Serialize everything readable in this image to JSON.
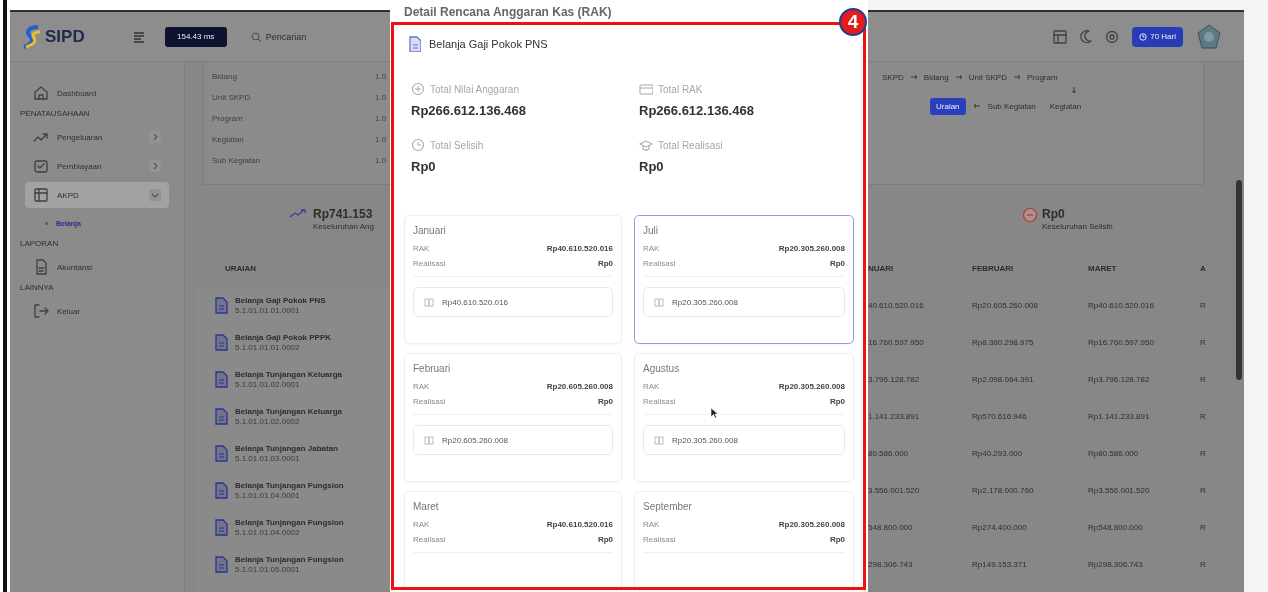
{
  "topbar": {
    "logo": "SIPD",
    "timer": "154.43 ms",
    "search_placeholder": "Pencarian",
    "days_button": "70 Hari"
  },
  "sidebar": {
    "items": [
      {
        "kind": "link",
        "label": "Dashboard",
        "selected": false
      },
      {
        "kind": "section",
        "label": "PENATAUSAHAAN"
      },
      {
        "kind": "link",
        "label": "Pengeluaran",
        "selected": false,
        "expanded": false
      },
      {
        "kind": "link",
        "label": "Pembiayaan",
        "selected": false,
        "expanded": false
      },
      {
        "kind": "link",
        "label": "AKPD",
        "selected": true,
        "expanded": true,
        "children": [
          {
            "label": "Belanja",
            "selected": true
          }
        ]
      },
      {
        "kind": "section",
        "label": "LAPORAN"
      },
      {
        "kind": "link",
        "label": "Akuntansi",
        "selected": false
      },
      {
        "kind": "section",
        "label": "LAINNYA"
      },
      {
        "kind": "link",
        "label": "Keluar",
        "selected": false
      }
    ]
  },
  "info": {
    "rows": [
      {
        "label": "Bidang",
        "value": "1.0"
      },
      {
        "label": "Unit SKPD",
        "value": "1.0"
      },
      {
        "label": "Program",
        "value": "1.0"
      },
      {
        "label": "Kegiatan",
        "value": "1.0"
      },
      {
        "label": "Sub Kegiatan",
        "value": "1.0"
      }
    ],
    "flow_top": [
      "SKPD",
      "Bidang",
      "Unit SKPD",
      "Program"
    ],
    "flow_bottom": [
      {
        "label": "Uraian",
        "selected": true
      },
      {
        "label": "Sub Kegiatan",
        "selected": false
      },
      {
        "label": "Kegiatan",
        "selected": false
      }
    ]
  },
  "stats": [
    {
      "kind": "trend",
      "amount": "Rp741.153",
      "caption": "Keseluruhan Ang"
    },
    {
      "kind": "diff",
      "amount": "Rp0",
      "caption": "Keseluruhan Selisih"
    }
  ],
  "table": {
    "columns": [
      "URAIAN",
      "NUARI",
      "FEBRUARI",
      "MARET",
      "A"
    ],
    "rows": [
      {
        "title": "Belanja Gaji Pokok PNS",
        "code": "5.1.01.01.01.0001",
        "values": [
          "40.610.520.016",
          "Rp20.605.260.008",
          "Rp40.610.520.016",
          "R"
        ]
      },
      {
        "title": "Belanja Gaji Pokok PPPK",
        "code": "5.1.01.01.01.0002",
        "values": [
          "16.760.597.950",
          "Rp8.380.298.975",
          "Rp16.760.597.950",
          "R"
        ]
      },
      {
        "title": "Belanja Tunjangan Keluarga",
        "code": "5.1.01.01.02.0001",
        "values": [
          "3.796.128.782",
          "Rp2.098.064.391",
          "Rp3.796.128.782",
          "R"
        ]
      },
      {
        "title": "Belanja Tunjangan Keluarga",
        "code": "5.1.01.01.02.0002",
        "values": [
          "1.141.233.891",
          "Rp570.616.946",
          "Rp1.141.233.891",
          "R"
        ]
      },
      {
        "title": "Belanja Tunjangan Jabatan",
        "code": "5.1.01.01.03.0001",
        "values": [
          "80.586.000",
          "Rp40.293.000",
          "Rp80.586.000",
          "R"
        ]
      },
      {
        "title": "Belanja Tunjangan Fungsion",
        "code": "5.1.01.01.04.0001",
        "values": [
          "3.556.001.520",
          "Rp2.178.000.760",
          "Rp3.556.001.520",
          "R"
        ]
      },
      {
        "title": "Belanja Tunjangan Fungsion",
        "code": "5.1.01.01.04.0002",
        "values": [
          "548.800.000",
          "Rp274.400.000",
          "Rp548.800.000",
          "R"
        ]
      },
      {
        "title": "Belanja Tunjangan Fungsion",
        "code": "5.1.01.01.05.0001",
        "values": [
          "298.306.743",
          "Rp149.153.371",
          "Rp298.306.743",
          "R"
        ]
      }
    ]
  },
  "modal": {
    "title": "Detail Rencana Anggaran Kas (RAK)",
    "item": "Belanja Gaji Pokok PNS",
    "summary": [
      {
        "label": "Total Nilai Anggaran",
        "value": "Rp266.612.136.468"
      },
      {
        "label": "Total RAK",
        "value": "Rp266.612.136.468"
      },
      {
        "label": "Total Selisih",
        "value": "Rp0"
      },
      {
        "label": "Total Realisasi",
        "value": "Rp0"
      }
    ],
    "months": [
      {
        "name": "Januari",
        "selected": false,
        "rows": [
          {
            "label": "RAK",
            "value": "Rp40.610.520.016"
          },
          {
            "label": "Realisasi",
            "value": "Rp0"
          }
        ],
        "input": "Rp40.610.520.016"
      },
      {
        "name": "Juli",
        "selected": true,
        "rows": [
          {
            "label": "RAK",
            "value": "Rp20.305.260.008"
          },
          {
            "label": "Realisasi",
            "value": "Rp0"
          }
        ],
        "input": "Rp20.305.260.008"
      },
      {
        "name": "Februari",
        "selected": false,
        "rows": [
          {
            "label": "RAK",
            "value": "Rp20.605.260.008"
          },
          {
            "label": "Realisasi",
            "value": "Rp0"
          }
        ],
        "input": "Rp20.605.260.008"
      },
      {
        "name": "Agustus",
        "selected": false,
        "rows": [
          {
            "label": "RAK",
            "value": "Rp20.305.260.008"
          },
          {
            "label": "Realisasi",
            "value": "Rp0"
          }
        ],
        "input": "Rp20.305.260.008"
      },
      {
        "name": "Maret",
        "selected": false,
        "rows": [
          {
            "label": "RAK",
            "value": "Rp40.610.520.016"
          },
          {
            "label": "Realisasi",
            "value": "Rp0"
          }
        ]
      },
      {
        "name": "September",
        "selected": false,
        "rows": [
          {
            "label": "RAK",
            "value": "Rp20.305.260.008"
          },
          {
            "label": "Realisasi",
            "value": "Rp0"
          }
        ]
      }
    ]
  },
  "annotation": {
    "number": "4"
  }
}
